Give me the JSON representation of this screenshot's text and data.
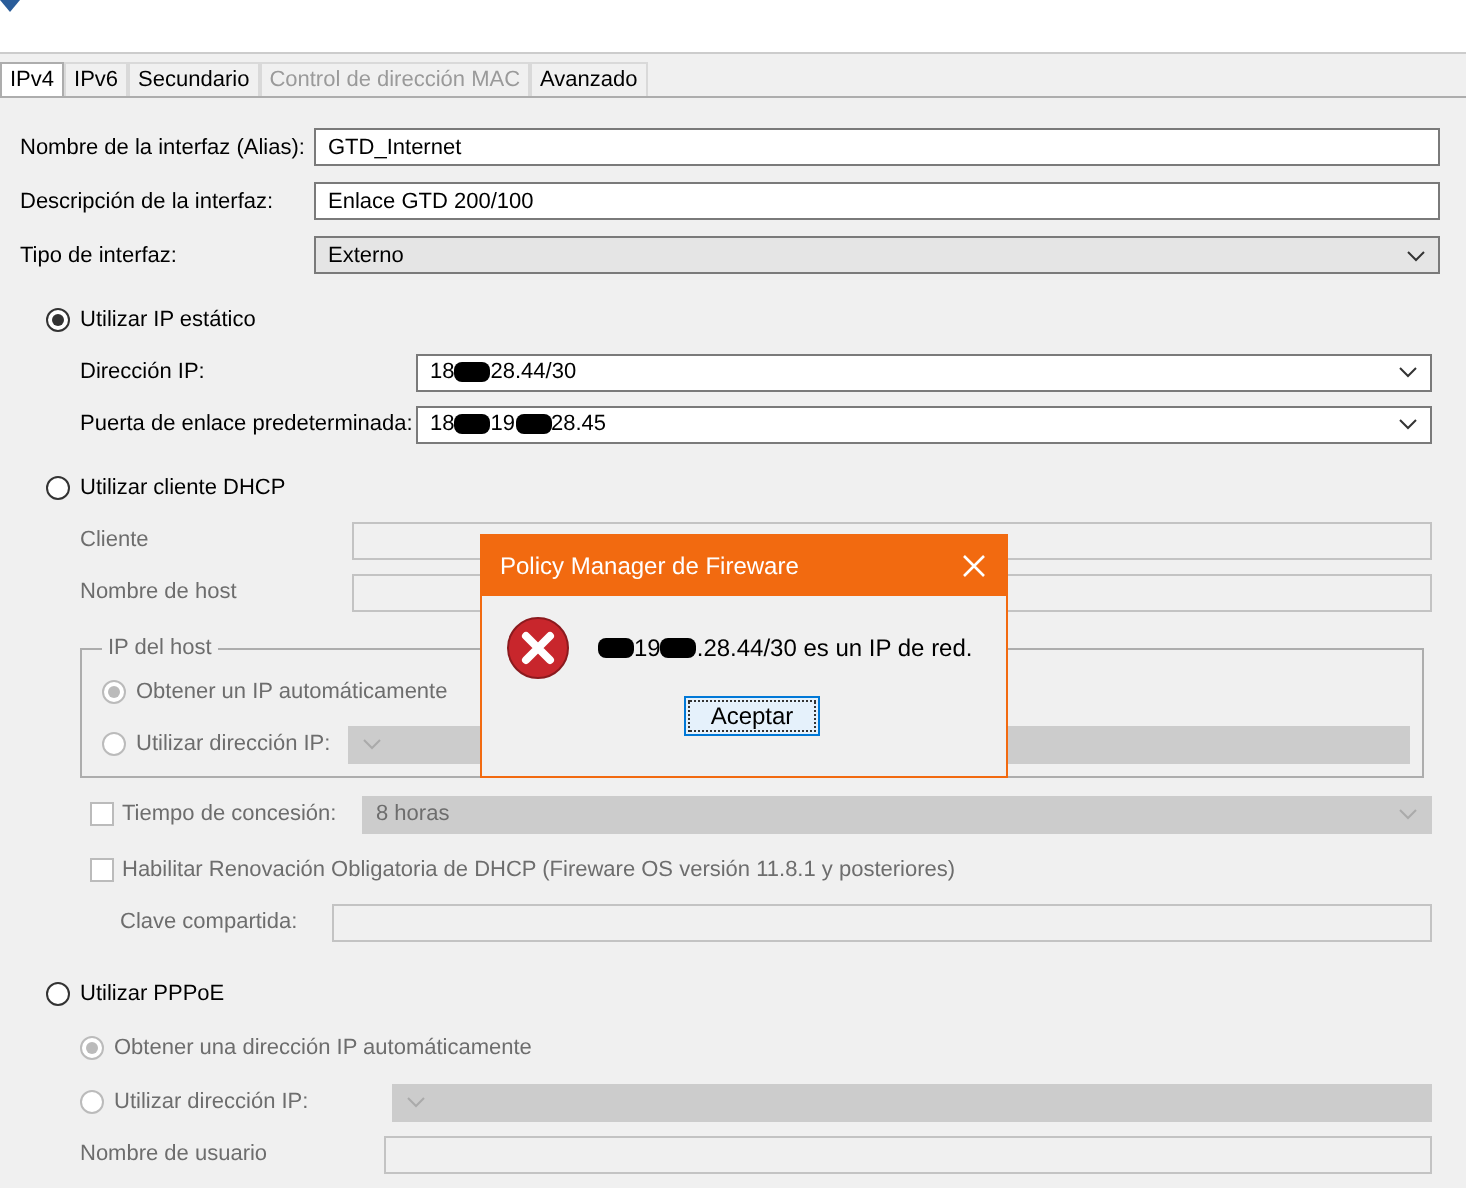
{
  "tabs": [
    {
      "label": "IPv4",
      "selected": true,
      "disabled": false
    },
    {
      "label": "IPv6",
      "selected": false,
      "disabled": false
    },
    {
      "label": "Secundario",
      "selected": false,
      "disabled": false
    },
    {
      "label": "Control de dirección MAC",
      "selected": false,
      "disabled": true
    },
    {
      "label": "Avanzado",
      "selected": false,
      "disabled": false
    }
  ],
  "general": [
    {
      "label": "Nombre de la interfaz (Alias):",
      "value": "GTD_Internet",
      "kind": "text"
    },
    {
      "label": "Descripción de la interfaz:",
      "value": "Enlace GTD 200/100",
      "kind": "text"
    },
    {
      "label": "Tipo de interfaz:",
      "value": "Externo",
      "kind": "select"
    }
  ],
  "static_ip": {
    "label": "Utilizar IP estático",
    "selected": true,
    "fields": [
      {
        "label": "Dirección IP:",
        "value_parts": [
          "18",
          "28.44/30"
        ]
      },
      {
        "label": "Puerta de enlace predeterminada:",
        "value_parts": [
          "18",
          "19",
          "28.45"
        ]
      }
    ]
  },
  "dhcp": {
    "label": "Utilizar cliente DHCP",
    "selected": false,
    "disabled": true,
    "fields": [
      {
        "label": "Cliente"
      },
      {
        "label": "Nombre de host"
      }
    ],
    "host_ip": {
      "legend": "IP del host",
      "options": [
        {
          "label": "Obtener un IP automáticamente",
          "selected": true,
          "kind": "radio"
        },
        {
          "label": "Utilizar dirección IP:",
          "selected": false,
          "kind": "radio-select"
        }
      ]
    },
    "lease": {
      "label": "Tiempo de concesión:",
      "checked": false,
      "value": "8 horas"
    },
    "renewal": {
      "label": "Habilitar Renovación Obligatoria de DHCP (Fireware OS versión 11.8.1 y posteriores)",
      "checked": false
    },
    "shared_key": {
      "label": "Clave compartida:"
    }
  },
  "pppoe": {
    "label": "Utilizar PPPoE",
    "selected": false,
    "disabled": true,
    "options": [
      {
        "label": "Obtener una dirección IP automáticamente",
        "selected": true,
        "kind": "radio"
      },
      {
        "label": "Utilizar dirección IP:",
        "selected": false,
        "kind": "radio-select"
      }
    ],
    "fields": [
      {
        "label": "Nombre de usuario"
      }
    ]
  },
  "dialog": {
    "title": "Policy Manager de Fireware",
    "leading_redaction": true,
    "message_parts": [
      "19",
      ".28.44/30 es un IP de red."
    ],
    "button": "Aceptar"
  }
}
